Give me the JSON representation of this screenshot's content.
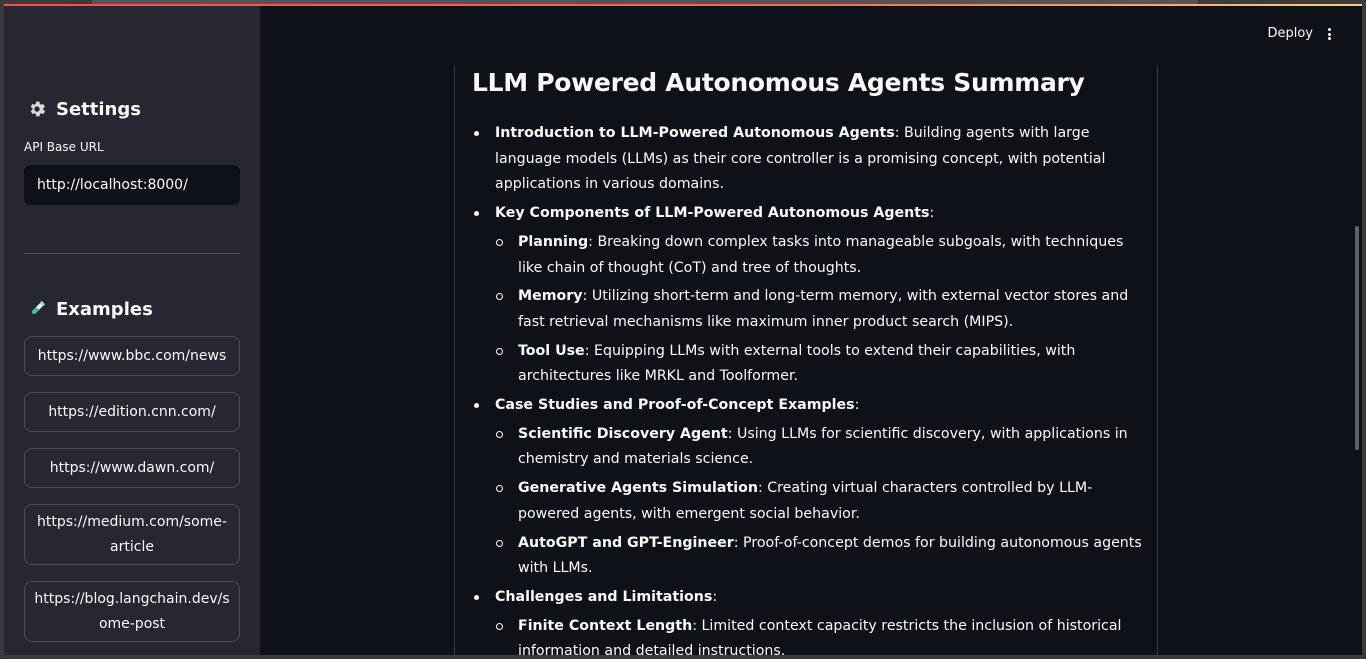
{
  "sidebar": {
    "settings_title": "Settings",
    "api_label": "API Base URL",
    "api_value": "http://localhost:8000/",
    "examples_title": "Examples",
    "examples": [
      "https://www.bbc.com/news",
      "https://edition.cnn.com/",
      "https://www.dawn.com/",
      "https://medium.com/some-article",
      "https://blog.langchain.dev/some-post"
    ]
  },
  "header": {
    "deploy_label": "Deploy",
    "menu_icon": "kebab-menu-icon"
  },
  "main": {
    "title": "LLM Powered Autonomous Agents Summary",
    "items": [
      {
        "bold": "Introduction to LLM-Powered Autonomous Agents",
        "text": ": Building agents with large language models (LLMs) as their core controller is a promising concept, with potential applications in various domains.",
        "sub": []
      },
      {
        "bold": "Key Components of LLM-Powered Autonomous Agents",
        "text": ":",
        "sub": [
          {
            "bold": "Planning",
            "text": ": Breaking down complex tasks into manageable subgoals, with techniques like chain of thought (CoT) and tree of thoughts."
          },
          {
            "bold": "Memory",
            "text": ": Utilizing short-term and long-term memory, with external vector stores and fast retrieval mechanisms like maximum inner product search (MIPS)."
          },
          {
            "bold": "Tool Use",
            "text": ": Equipping LLMs with external tools to extend their capabilities, with architectures like MRKL and Toolformer."
          }
        ]
      },
      {
        "bold": "Case Studies and Proof-of-Concept Examples",
        "text": ":",
        "sub": [
          {
            "bold": "Scientific Discovery Agent",
            "text": ": Using LLMs for scientific discovery, with applications in chemistry and materials science."
          },
          {
            "bold": "Generative Agents Simulation",
            "text": ": Creating virtual characters controlled by LLM-powered agents, with emergent social behavior."
          },
          {
            "bold": "AutoGPT and GPT-Engineer",
            "text": ": Proof-of-concept demos for building autonomous agents with LLMs."
          }
        ]
      },
      {
        "bold": "Challenges and Limitations",
        "text": ":",
        "sub": [
          {
            "bold": "Finite Context Length",
            "text": ": Limited context capacity restricts the inclusion of historical information and detailed instructions."
          }
        ]
      }
    ]
  }
}
